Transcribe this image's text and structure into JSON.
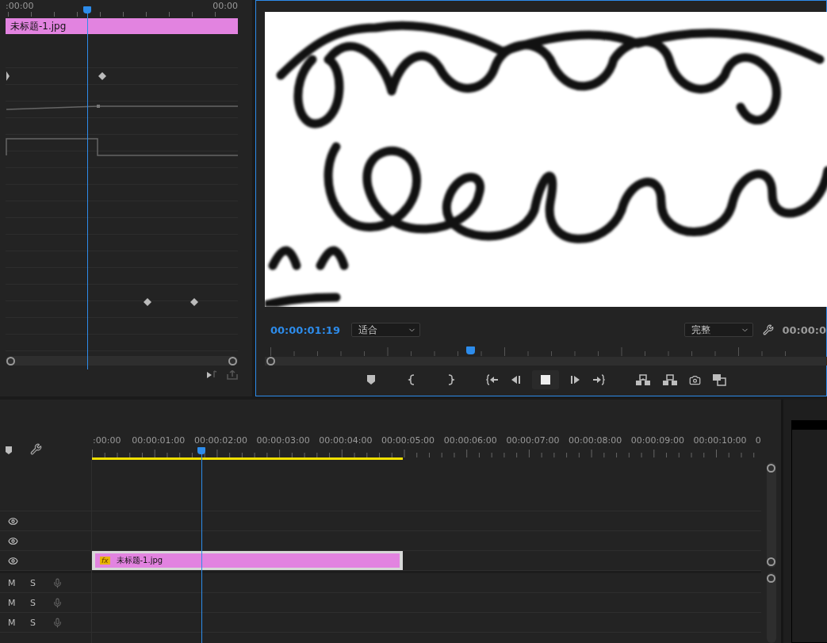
{
  "effect_controls": {
    "ruler_labels": [
      ":00:00",
      "00:00"
    ],
    "clip_name": "未标题-1.jpg"
  },
  "program_monitor": {
    "timecode": "00:00:01:19",
    "zoom_select": "适合",
    "quality_select": "完整",
    "duration": "00:00:0",
    "scrubber": {
      "level": 0.365
    }
  },
  "timeline": {
    "ruler_labels": [
      ":00:00",
      "00:00:01:00",
      "00:00:02:00",
      "00:00:03:00",
      "00:00:04:00",
      "00:00:05:00",
      "00:00:06:00",
      "00:00:07:00",
      "00:00:08:00",
      "00:00:09:00",
      "00:00:10:00",
      "0"
    ],
    "clip": {
      "name": "未标题-1.jpg",
      "fx_label": "fx",
      "effects_applied": true
    },
    "video_tracks": [
      {
        "visible": true
      },
      {
        "visible": true
      },
      {
        "visible": true
      }
    ],
    "audio_tracks": [
      {
        "mute": "M",
        "solo": "S"
      },
      {
        "mute": "M",
        "solo": "S"
      },
      {
        "mute": "M",
        "solo": "S"
      }
    ]
  }
}
